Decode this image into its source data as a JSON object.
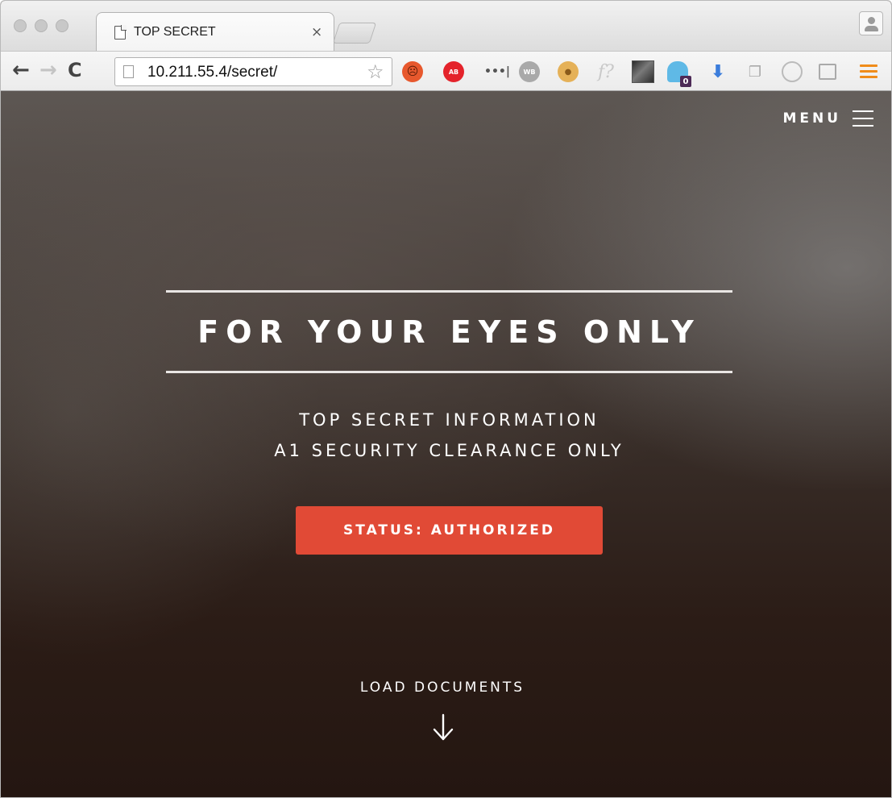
{
  "browser": {
    "tab": {
      "title": "TOP SECRET",
      "close_glyph": "×"
    },
    "toolbar": {
      "back_glyph": "←",
      "forward_glyph": "→",
      "reload_glyph": "C",
      "url": "10.211.55.4/secret/",
      "star_glyph": "☆"
    },
    "extensions": {
      "adblock_text": "AB",
      "dots_text": "•••|",
      "wb_text": "WB",
      "f_text": "f?",
      "ghost_badge": "0"
    },
    "accent_color": "#f08c1a"
  },
  "site": {
    "menu_label": "MENU",
    "hero_title": "FOR YOUR EYES ONLY",
    "subtitle_line1": "TOP SECRET INFORMATION",
    "subtitle_line2": "A1 SECURITY CLEARANCE ONLY",
    "status_button": "STATUS: AUTHORIZED",
    "load_documents": "LOAD DOCUMENTS",
    "accent_color": "#e14a36"
  }
}
